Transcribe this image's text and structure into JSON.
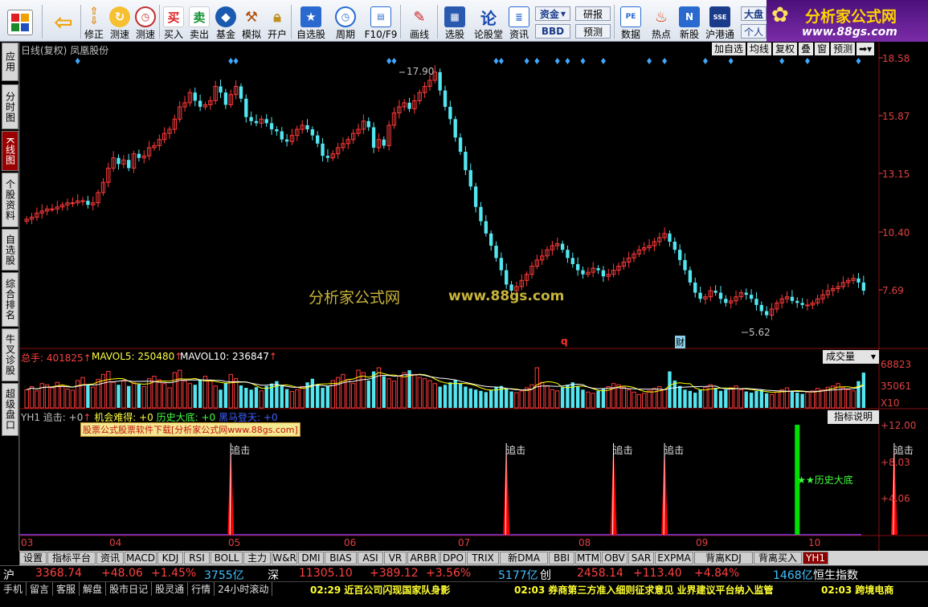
{
  "toolbar": {
    "buttons": [
      {
        "id": "xiuzheng",
        "label": "修正",
        "icon": "chevron-up-down-icon"
      },
      {
        "id": "cesu",
        "label": "测速",
        "icon": "clock-icon"
      },
      {
        "id": "mairu",
        "label": "买入",
        "icon": "buy-icon",
        "glyph": "买"
      },
      {
        "id": "maichu",
        "label": "卖出",
        "icon": "sell-icon",
        "glyph": "卖"
      },
      {
        "id": "jijin",
        "label": "基金",
        "icon": "fund-icon"
      },
      {
        "id": "moni",
        "label": "模拟",
        "icon": "hammer-icon"
      },
      {
        "id": "kaihu",
        "label": "开户",
        "icon": "lock-icon"
      },
      {
        "id": "zixuangu",
        "label": "自选股",
        "icon": "star-icon"
      },
      {
        "id": "zhouqi",
        "label": "周期",
        "icon": "clock-icon"
      },
      {
        "id": "f10",
        "label": "F10/F9",
        "icon": "document-icon"
      },
      {
        "id": "huaxian",
        "label": "画线",
        "icon": "pen-icon"
      },
      {
        "id": "xuangu",
        "label": "选股",
        "icon": "chart-icon"
      },
      {
        "id": "luntan",
        "label": "论股堂",
        "icon": "forum-icon",
        "glyph": "论"
      },
      {
        "id": "zixun",
        "label": "资讯",
        "icon": "news-icon"
      },
      {
        "id": "shuju",
        "label": "数据",
        "icon": "data-icon",
        "glyph": "PE"
      },
      {
        "id": "redian",
        "label": "热点",
        "icon": "fire-icon"
      },
      {
        "id": "xingu",
        "label": "新股",
        "icon": "new-stock-icon",
        "glyph": "N"
      },
      {
        "id": "hugangtong",
        "label": "沪港通",
        "icon": "hk-icon"
      }
    ],
    "zijin": "资金",
    "bbd": "BBD",
    "yanbao": "研报",
    "yuce": "预测",
    "dapan": "大盘",
    "gerenzhongxin": "个人"
  },
  "logo": {
    "title": "分析家公式网",
    "url": "www.88gs.com"
  },
  "side_tabs": [
    "应用",
    "分时图",
    "K线图",
    "个股资料",
    "自选股",
    "综合排名",
    "牛叉诊股",
    "超级盘口"
  ],
  "chart_header": {
    "title": "日线(复权)",
    "stock": "凤凰股份",
    "buttons": [
      "加自选",
      "均线",
      "复权",
      "叠",
      "窗",
      "预测"
    ]
  },
  "chart_data": [
    {
      "type": "candlestick",
      "title": "日线(复权) 凤凰股份",
      "y_ticks": [
        "18.58",
        "15.87",
        "13.15",
        "10.40",
        "7.69"
      ],
      "ylim": [
        5.0,
        18.6
      ],
      "x_ticks": [
        "03",
        "04",
        "05",
        "06",
        "07",
        "08",
        "09",
        "10"
      ],
      "annotations": [
        {
          "label": "17.90",
          "value": 17.9
        },
        {
          "label": "5.62",
          "value": 5.62
        }
      ],
      "markers": [
        "q",
        "财"
      ],
      "series": [
        {
          "name": "price",
          "values": [
            10.7,
            10.8,
            11,
            11.1,
            11.2,
            11.2,
            11.3,
            11.4,
            11.5,
            11.5,
            11.6,
            11.6,
            11.4,
            11.5,
            12,
            12.5,
            13.2,
            13.7,
            13.4,
            13.6,
            13.2,
            13.9,
            13.7,
            13.8,
            14.2,
            14.3,
            14.6,
            14.9,
            15.1,
            15.6,
            16.2,
            16.4,
            16.9,
            16.5,
            16.2,
            16.3,
            16.5,
            17.2,
            16.9,
            16.3,
            16.8,
            17.2,
            16.6,
            15.7,
            15.5,
            15.4,
            15.6,
            15.4,
            15.1,
            15.0,
            14.6,
            14.5,
            14.8,
            15.1,
            15.3,
            15.1,
            14.8,
            14.4,
            13.8,
            13.7,
            13.9,
            14.2,
            14.4,
            14.6,
            14.9,
            15.1,
            15.5,
            15.2,
            14.2,
            14.6,
            14.3,
            15.3,
            15.9,
            16.2,
            16.4,
            16.1,
            16.5,
            16.9,
            17.2,
            17.5,
            17.9,
            17.0,
            16.2,
            15.6,
            14.7,
            14.0,
            13.1,
            12.3,
            11.3,
            10.6,
            10.0,
            9.4,
            8.8,
            8.2,
            7.5,
            7.2,
            7.4,
            7.7,
            8.0,
            8.4,
            8.7,
            8.9,
            9.2,
            9.4,
            9.5,
            9.2,
            8.8,
            8.5,
            8.2,
            8.0,
            8.1,
            8.3,
            8.2,
            7.9,
            8.0,
            8.2,
            8.4,
            8.6,
            8.8,
            9.0,
            9.2,
            9.3,
            9.4,
            9.6,
            9.8,
            10.0,
            9.6,
            9.2,
            8.7,
            8.2,
            7.6,
            7.1,
            6.8,
            6.9,
            7.2,
            7.1,
            6.8,
            6.6,
            6.7,
            6.9,
            7.1,
            7.0,
            6.8,
            6.5,
            6.2,
            6.0,
            6.3,
            6.6,
            6.8,
            6.9,
            6.7,
            6.6,
            6.5,
            6.5,
            6.6,
            6.8,
            7.0,
            7.2,
            7.3,
            7.4,
            7.6,
            7.7,
            7.8,
            7.6,
            7.2
          ]
        }
      ]
    },
    {
      "type": "bar",
      "title": "成交量",
      "labels": {
        "total": "总手: 401825",
        "mavol5": "MAVOL5: 250480",
        "mavol10": "MAVOL10: 236847"
      },
      "y_ticks": [
        "68823",
        "35061",
        "X10"
      ],
      "series": [
        {
          "name": "volume",
          "values": [
            30,
            35,
            28,
            40,
            38,
            33,
            42,
            36,
            31,
            29,
            45,
            50,
            38,
            34,
            47,
            55,
            60,
            42,
            38,
            44,
            36,
            41,
            39,
            35,
            48,
            52,
            46,
            40,
            33,
            58,
            62,
            44,
            40,
            38,
            47,
            52,
            45,
            36,
            30,
            41,
            55,
            48,
            37,
            33,
            30,
            34,
            28,
            36,
            40,
            44,
            38,
            31,
            27,
            30,
            35,
            42,
            48,
            39,
            33,
            36,
            45,
            50,
            55,
            47,
            40,
            62,
            58,
            45,
            60,
            66,
            52,
            48,
            44,
            52,
            58,
            62,
            55,
            50,
            48,
            45,
            40,
            35,
            38,
            42,
            46,
            40,
            35,
            32,
            30,
            28,
            26,
            30,
            34,
            36,
            31,
            27,
            25,
            28,
            33,
            38,
            66,
            42,
            36,
            30,
            28,
            34,
            38,
            42,
            36,
            30,
            26,
            24,
            28,
            32,
            35,
            40,
            38,
            34,
            30,
            26,
            22,
            24,
            28,
            32,
            35,
            30,
            60,
            45,
            36,
            30,
            28,
            25,
            30,
            34,
            38,
            33,
            28,
            30,
            33,
            36,
            30,
            27,
            25,
            28,
            30,
            24,
            22,
            26,
            30,
            33,
            28,
            25,
            23,
            26,
            28,
            32,
            30,
            34,
            36,
            40,
            33,
            30,
            28,
            44,
            58
          ]
        }
      ],
      "ma_series": [
        {
          "name": "MAVOL5"
        },
        {
          "name": "MAVOL10"
        }
      ]
    },
    {
      "type": "bar",
      "title": "YH1",
      "legend": [
        "YH1 追击: +0",
        "机会难得: +0",
        "历史大底: +0",
        "黑马登天: +0"
      ],
      "y_ticks": [
        "+12.00",
        "+8.03",
        "+4.06"
      ],
      "events": [
        {
          "label": "追击",
          "x_index": 40,
          "value": 10
        },
        {
          "label": "追击",
          "x_index": 94,
          "value": 10
        },
        {
          "label": "追击",
          "x_index": 115,
          "value": 10
        },
        {
          "label": "追击",
          "x_index": 125,
          "value": 10
        },
        {
          "label": "★★历史大底",
          "x_index": 151,
          "value": 12
        },
        {
          "label": "追击",
          "x_index": 170,
          "value": 10
        }
      ]
    }
  ],
  "watermark": {
    "text": "分析家公式网",
    "url": "www.88gs.com"
  },
  "ad_banner": "股票公式股票软件下载[分析家公式网www.88gs.com]",
  "vol_dropdown": "成交量",
  "indicator_btn": "指标说明",
  "bottom_tabs": [
    "设置",
    "指标平台",
    "资讯",
    "MACD",
    "KDJ",
    "RSI",
    "BOLL",
    "主力",
    "W&R",
    "DMI",
    "BIAS",
    "ASI",
    "VR",
    "ARBR",
    "DPO",
    "TRIX",
    "新DMA",
    "BBI",
    "MTM",
    "OBV",
    "SAR",
    "EXPMA",
    "背离KDJ",
    "背离买入",
    "YH1"
  ],
  "status_bar": {
    "sh_label": "沪",
    "sh_index": "3368.74",
    "sh_change": "+48.06",
    "sh_pct": "+1.45%",
    "sh_amount": "3755亿",
    "sz_label": "深",
    "sz_index": "11305.10",
    "sz_change": "+389.12",
    "sz_pct": "+3.56%",
    "sz_amount": "5177亿",
    "cy_label": "创",
    "cy_index": "2458.14",
    "cy_change": "+113.40",
    "cy_pct": "+4.84%",
    "cy_amount": "1468亿",
    "hs_label": "恒生指数"
  },
  "status2": {
    "tabs": [
      "手机",
      "留言",
      "客服",
      "解盘",
      "股市日记",
      "股灵通",
      "行情",
      "24小时滚动"
    ],
    "news": [
      "02:29 近百公司闪现国家队身影",
      "02:03 券商第三方准入细则征求意见 业界建议平台纳入监管",
      "02:03 跨境电商"
    ]
  },
  "colors": {
    "up": "#ff3b3b",
    "down": "#54e6f0",
    "axis": "#e04040",
    "grid": "#8a1010",
    "ma5": "#ffff00",
    "ma10": "#ffffff",
    "signal": "#ff0000",
    "bottom_signal": "#00e000"
  }
}
